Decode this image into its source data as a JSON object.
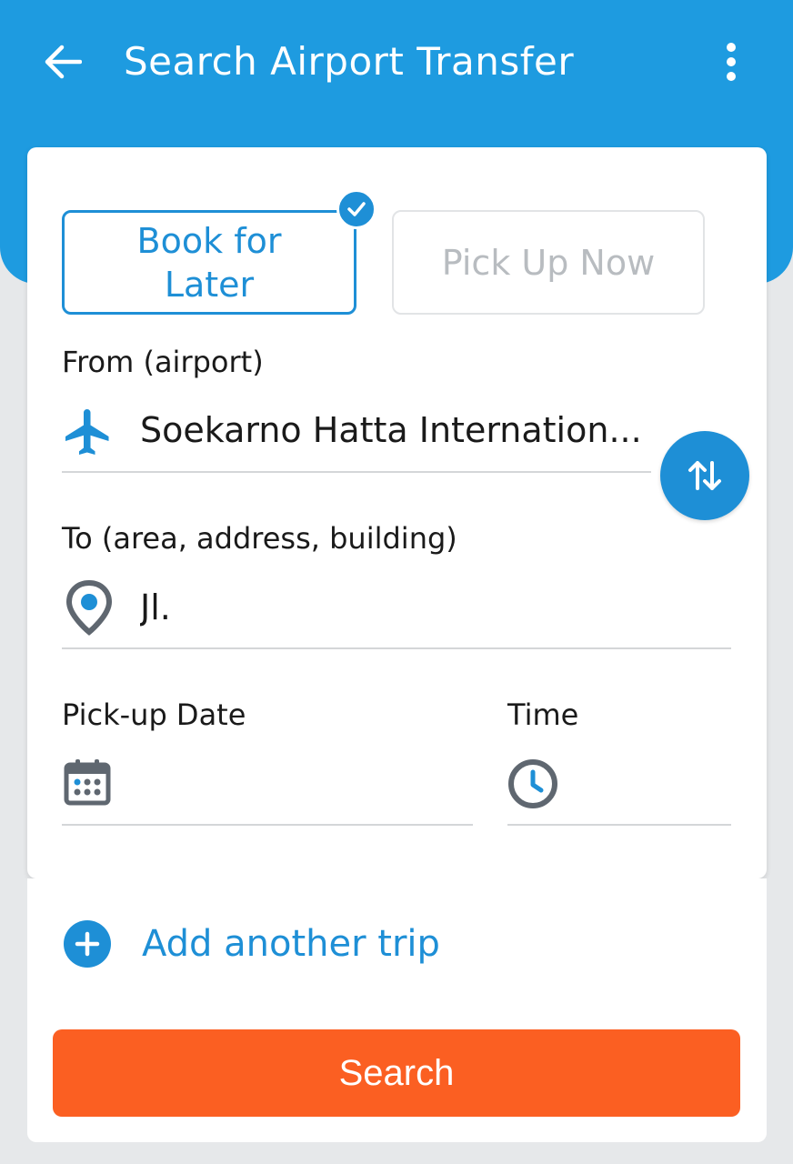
{
  "header": {
    "title": "Search Airport Transfer",
    "back_icon": "arrow-left-icon",
    "menu_icon": "more-vertical-icon"
  },
  "booking_mode": {
    "options": [
      {
        "label": "Book for\nLater",
        "selected": true
      },
      {
        "label": "Pick Up Now",
        "selected": false
      }
    ]
  },
  "from": {
    "label": "From (airport)",
    "value": "Soekarno Hatta Internation...",
    "icon": "airplane-icon"
  },
  "to": {
    "label": "To (area, address, building)",
    "value": "Jl.",
    "icon": "location-pin-icon"
  },
  "pickup_date": {
    "label": "Pick-up Date",
    "value": "",
    "icon": "calendar-icon"
  },
  "time": {
    "label": "Time",
    "value": "",
    "icon": "clock-icon"
  },
  "add_trip": {
    "label": "Add another trip",
    "icon": "plus-circle-icon"
  },
  "search": {
    "label": "Search"
  },
  "colors": {
    "primary_blue": "#1e9be0",
    "accent_blue": "#1e8fd6",
    "search_orange": "#fb5f22",
    "background": "#e6e8ea"
  }
}
